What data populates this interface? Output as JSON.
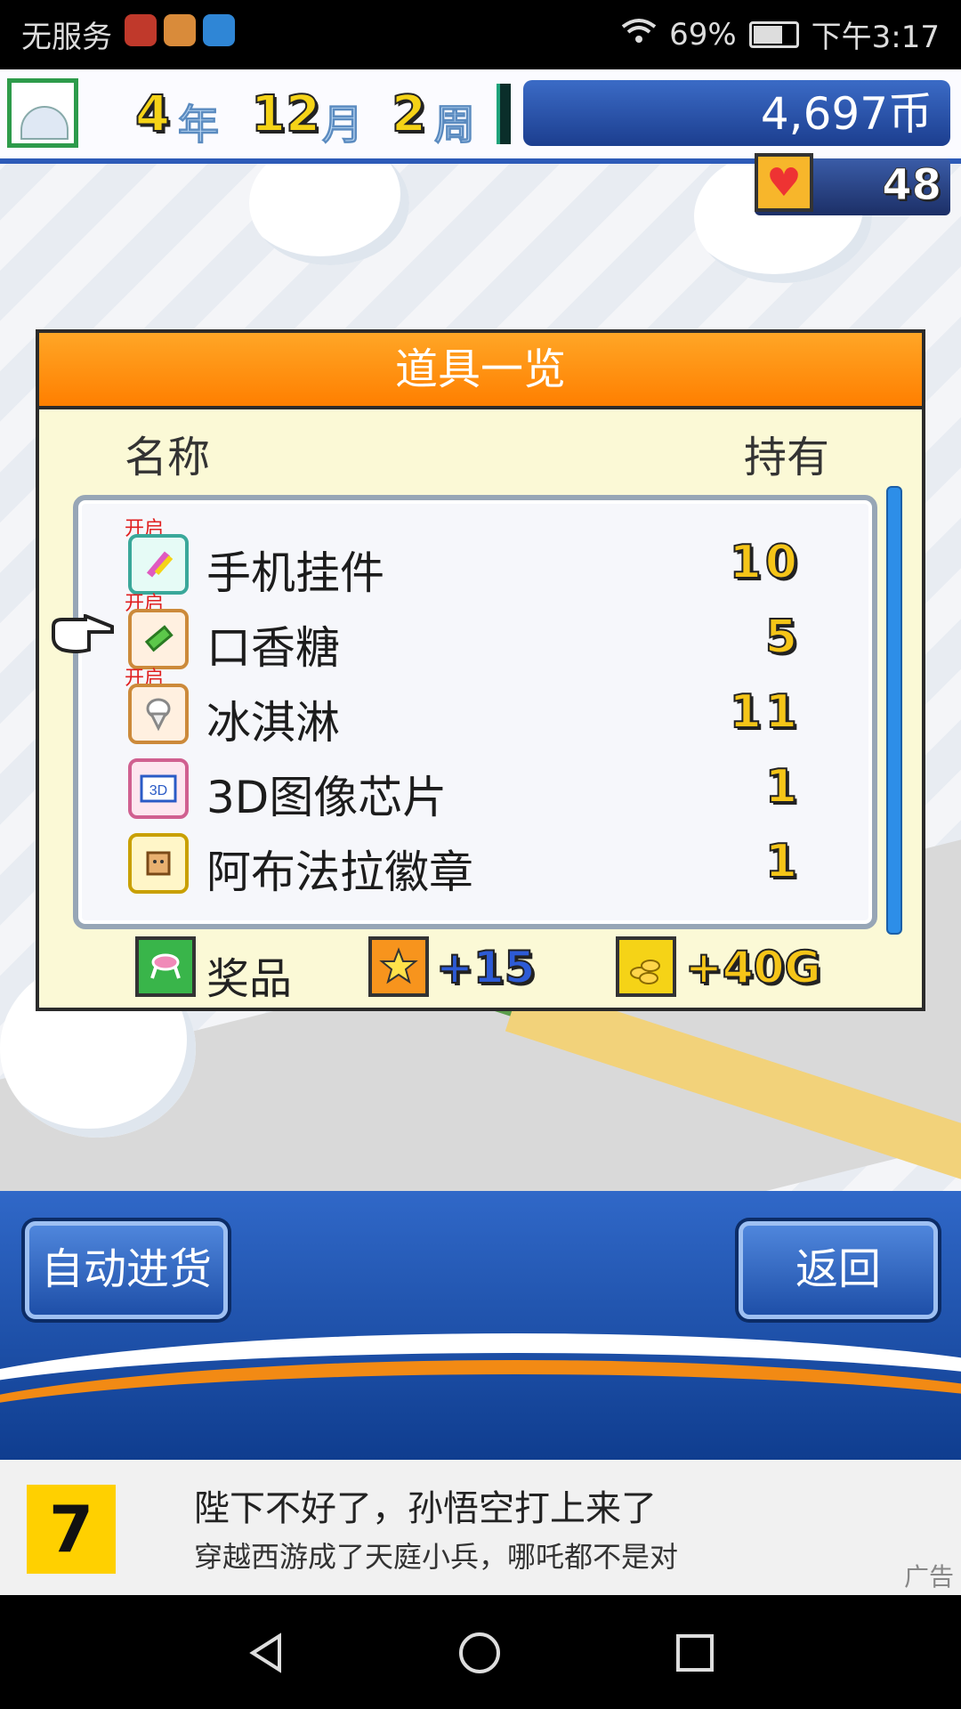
{
  "status_bar": {
    "carrier": "无服务",
    "battery": "69%",
    "time": "下午3:17"
  },
  "hud": {
    "year_num": "4",
    "year_unit": "年",
    "month_num": "12",
    "month_unit": "月",
    "week_num": "2",
    "week_unit": "周",
    "money": "4,697币",
    "hearts": "48"
  },
  "dialog": {
    "title": "道具一览",
    "col_name": "名称",
    "col_owned": "持有",
    "items": [
      {
        "name": "手机挂件",
        "qty": "10",
        "open": "开启",
        "icon": "phone-charm-icon"
      },
      {
        "name": "口香糖",
        "qty": "5",
        "open": "开启",
        "icon": "gum-icon"
      },
      {
        "name": "冰淇淋",
        "qty": "11",
        "open": "开启",
        "icon": "ice-cream-icon"
      },
      {
        "name": "3D图像芯片",
        "qty": "1",
        "open": "",
        "icon": "3d-chip-icon"
      },
      {
        "name": "阿布法拉徽章",
        "qty": "1",
        "open": "",
        "icon": "badge-icon"
      }
    ],
    "prize_label": "奖品",
    "star_bonus": "+15",
    "gold_bonus": "+40G"
  },
  "buttons": {
    "auto_stock": "自动进货",
    "back": "返回"
  },
  "ad": {
    "logo": "7",
    "line1": "陛下不好了，孙悟空打上来了",
    "line2": "穿越西游成了天庭小兵，哪吒都不是对",
    "tag": "广告"
  }
}
